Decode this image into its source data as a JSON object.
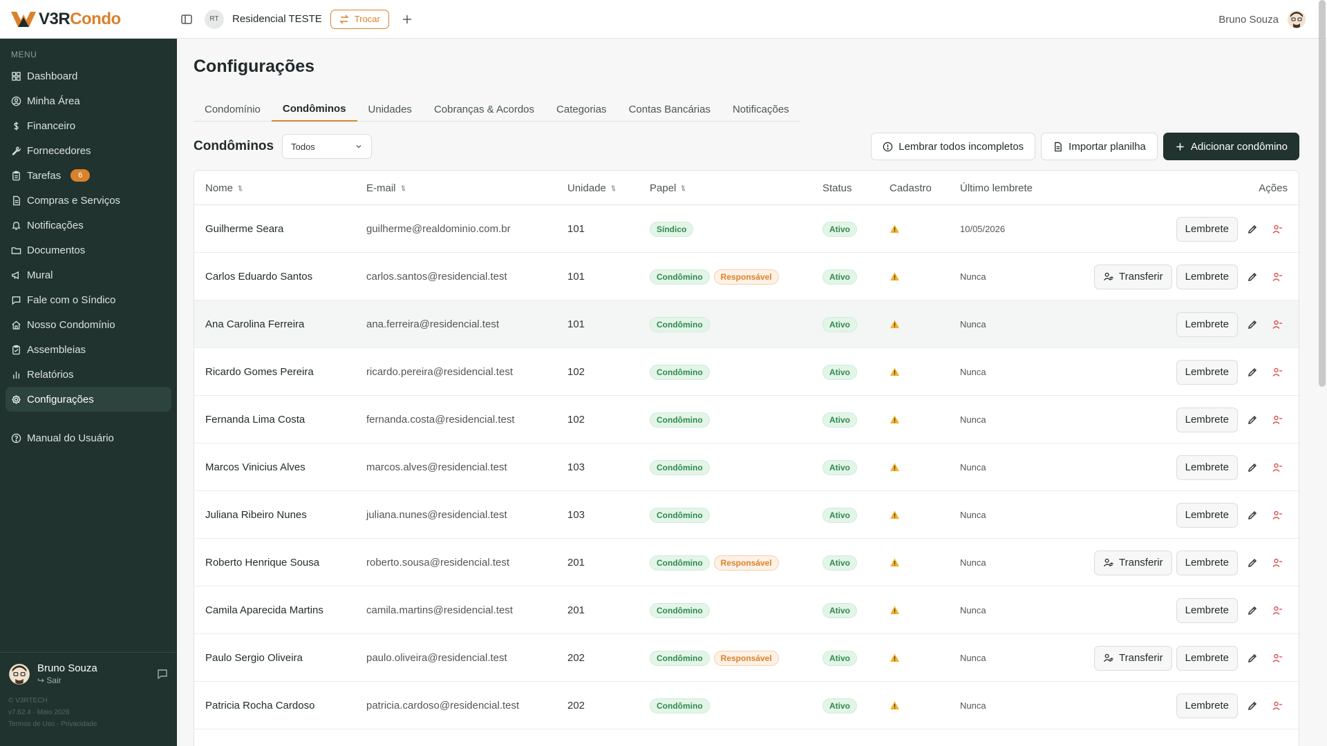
{
  "header": {
    "logo_part1": "V3R",
    "logo_part2": "Condo",
    "cond_initials": "RT",
    "cond_name": "Residencial TESTE",
    "trocar_label": "Trocar",
    "user_name": "Bruno Souza"
  },
  "sidebar": {
    "menu_label": "MENU",
    "items": [
      {
        "label": "Dashboard",
        "icon": "grid-icon"
      },
      {
        "label": "Minha Área",
        "icon": "user-circle-icon"
      },
      {
        "label": "Financeiro",
        "icon": "dollar-icon"
      },
      {
        "label": "Fornecedores",
        "icon": "wrench-icon"
      },
      {
        "label": "Tarefas",
        "icon": "clipboard-icon",
        "badge": "6"
      },
      {
        "label": "Compras e Serviços",
        "icon": "file-icon"
      },
      {
        "label": "Notificações",
        "icon": "bell-icon"
      },
      {
        "label": "Documentos",
        "icon": "folder-icon"
      },
      {
        "label": "Mural",
        "icon": "megaphone-icon"
      },
      {
        "label": "Fale com o Síndico",
        "icon": "chat-icon"
      },
      {
        "label": "Nosso Condomínio",
        "icon": "home-icon"
      },
      {
        "label": "Assembleias",
        "icon": "clipboard-list-icon"
      },
      {
        "label": "Relatórios",
        "icon": "bar-chart-icon"
      },
      {
        "label": "Configurações",
        "icon": "gear-icon",
        "active": true
      }
    ],
    "manual_label": "Manual do Usuário",
    "user_name": "Bruno Souza",
    "logout_label": "Sair",
    "legal_1": "© V3RTECH",
    "legal_2": "v7.62.4 · Maio 2026",
    "legal_3": "Termos de Uso · Privacidade"
  },
  "page": {
    "title": "Configurações",
    "tabs": [
      "Condomínio",
      "Condôminos",
      "Unidades",
      "Cobranças & Acordos",
      "Categorias",
      "Contas Bancárias",
      "Notificações"
    ],
    "active_tab": 1,
    "section_title": "Condôminos",
    "filter_value": "Todos",
    "btn_lembrar": "Lembrar todos incompletos",
    "btn_importar": "Importar planilha",
    "btn_adicionar": "Adicionar condômino"
  },
  "table": {
    "headers": {
      "nome": "Nome",
      "email": "E-mail",
      "unidade": "Unidade",
      "papel": "Papel",
      "status": "Status",
      "cadastro": "Cadastro",
      "ultimo": "Último lembrete",
      "acoes": "Ações"
    },
    "action_labels": {
      "lembrete": "Lembrete",
      "transferir": "Transferir"
    },
    "rows": [
      {
        "nome": "Guilherme Seara",
        "email": "guilherme@realdominio.com.br",
        "unidade": "101",
        "papel": "Síndico",
        "responsavel": "",
        "status": "Ativo",
        "ultimo": "10/05/2026",
        "transferir": false
      },
      {
        "nome": "Carlos Eduardo Santos",
        "email": "carlos.santos@residencial.test",
        "unidade": "101",
        "papel": "Condômino",
        "responsavel": "Responsável",
        "status": "Ativo",
        "ultimo": "Nunca",
        "transferir": true
      },
      {
        "nome": "Ana Carolina Ferreira",
        "email": "ana.ferreira@residencial.test",
        "unidade": "101",
        "papel": "Condômino",
        "responsavel": "",
        "status": "Ativo",
        "ultimo": "Nunca",
        "transferir": false,
        "highlight": true
      },
      {
        "nome": "Ricardo Gomes Pereira",
        "email": "ricardo.pereira@residencial.test",
        "unidade": "102",
        "papel": "Condômino",
        "responsavel": "",
        "status": "Ativo",
        "ultimo": "Nunca",
        "transferir": false
      },
      {
        "nome": "Fernanda Lima Costa",
        "email": "fernanda.costa@residencial.test",
        "unidade": "102",
        "papel": "Condômino",
        "responsavel": "",
        "status": "Ativo",
        "ultimo": "Nunca",
        "transferir": false
      },
      {
        "nome": "Marcos Vinicius Alves",
        "email": "marcos.alves@residencial.test",
        "unidade": "103",
        "papel": "Condômino",
        "responsavel": "",
        "status": "Ativo",
        "ultimo": "Nunca",
        "transferir": false
      },
      {
        "nome": "Juliana Ribeiro Nunes",
        "email": "juliana.nunes@residencial.test",
        "unidade": "103",
        "papel": "Condômino",
        "responsavel": "",
        "status": "Ativo",
        "ultimo": "Nunca",
        "transferir": false
      },
      {
        "nome": "Roberto Henrique Sousa",
        "email": "roberto.sousa@residencial.test",
        "unidade": "201",
        "papel": "Condômino",
        "responsavel": "Responsável",
        "status": "Ativo",
        "ultimo": "Nunca",
        "transferir": true
      },
      {
        "nome": "Camila Aparecida Martins",
        "email": "camila.martins@residencial.test",
        "unidade": "201",
        "papel": "Condômino",
        "responsavel": "",
        "status": "Ativo",
        "ultimo": "Nunca",
        "transferir": false
      },
      {
        "nome": "Paulo Sergio Oliveira",
        "email": "paulo.oliveira@residencial.test",
        "unidade": "202",
        "papel": "Condômino",
        "responsavel": "Responsável",
        "status": "Ativo",
        "ultimo": "Nunca",
        "transferir": true
      },
      {
        "nome": "Patricia Rocha Cardoso",
        "email": "patricia.cardoso@residencial.test",
        "unidade": "202",
        "papel": "Condômino",
        "responsavel": "",
        "status": "Ativo",
        "ultimo": "Nunca",
        "transferir": false
      }
    ]
  },
  "colors": {
    "accent": "#d9822b",
    "sidebar_bg": "#20332e",
    "status_green": "#2f8a4b"
  }
}
